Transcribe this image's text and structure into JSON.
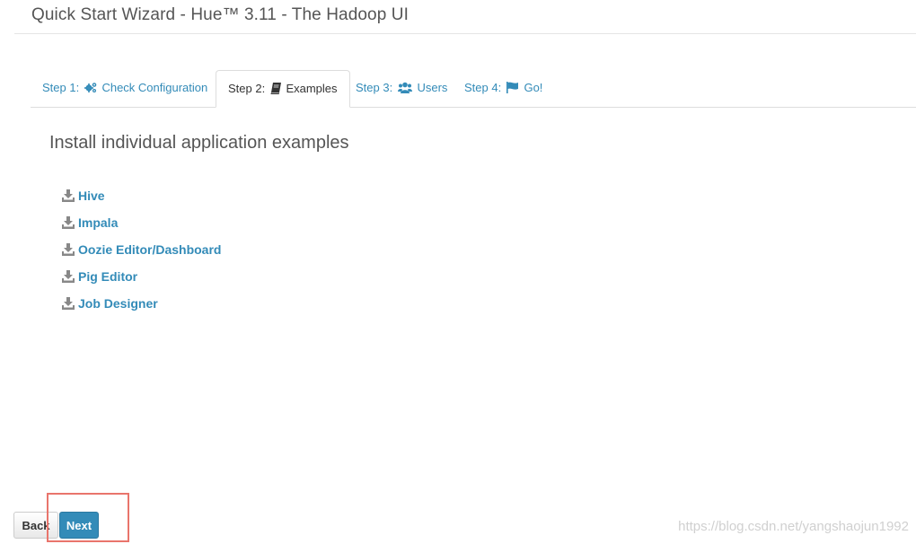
{
  "header": {
    "title": "Quick Start Wizard - Hue™ 3.11 - The Hadoop UI"
  },
  "tabs": [
    {
      "prefix": "Step 1:",
      "icon": "cogs-icon",
      "label": "Check Configuration",
      "active": false
    },
    {
      "prefix": "Step 2:",
      "icon": "book-icon",
      "label": "Examples",
      "active": true
    },
    {
      "prefix": "Step 3:",
      "icon": "users-icon",
      "label": "Users",
      "active": false
    },
    {
      "prefix": "Step 4:",
      "icon": "flag-icon",
      "label": "Go!",
      "active": false
    }
  ],
  "main": {
    "section_title": "Install individual application examples",
    "examples": [
      {
        "label": "Hive",
        "icon": "download-icon"
      },
      {
        "label": "Impala",
        "icon": "download-icon"
      },
      {
        "label": "Oozie Editor/Dashboard",
        "icon": "download-icon"
      },
      {
        "label": "Pig Editor",
        "icon": "download-icon"
      },
      {
        "label": "Job Designer",
        "icon": "download-icon"
      }
    ]
  },
  "footer": {
    "back_label": "Back",
    "next_label": "Next"
  },
  "watermark": "https://blog.csdn.net/yangshaojun1992",
  "colors": {
    "link": "#338bb8",
    "primary_button": "#338bb8",
    "highlight": "#e9756c"
  }
}
